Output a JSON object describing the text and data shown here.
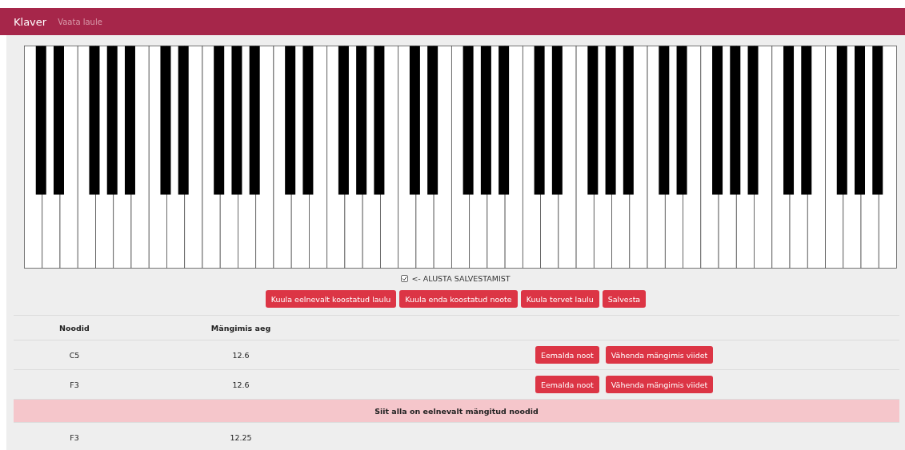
{
  "navbar": {
    "brand": "Klaver",
    "links": [
      {
        "label": "Vaata laule"
      }
    ]
  },
  "recording": {
    "label": "<- ALUSTA SALVESTAMIST",
    "checked": true
  },
  "buttons": [
    {
      "label": "Kuula eelnevalt koostatud laulu"
    },
    {
      "label": "Kuula enda koostatud noote"
    },
    {
      "label": "Kuula tervet laulu"
    },
    {
      "label": "Salvesta"
    }
  ],
  "table": {
    "columns": [
      "Noodid",
      "Mängimis aeg"
    ],
    "rows": [
      {
        "kind": "note",
        "cells": [
          "C5",
          "12.6"
        ],
        "actions": [
          "Eemalda noot",
          "Vähenda mängimis viidet"
        ]
      },
      {
        "kind": "note",
        "cells": [
          "F3",
          "12.6"
        ],
        "actions": [
          "Eemalda noot",
          "Vähenda mängimis viidet"
        ]
      },
      {
        "kind": "separator",
        "text": "Siit alla on eelnevalt mängitud noodid"
      },
      {
        "kind": "note",
        "cells": [
          "F3",
          "12.25"
        ]
      }
    ]
  }
}
